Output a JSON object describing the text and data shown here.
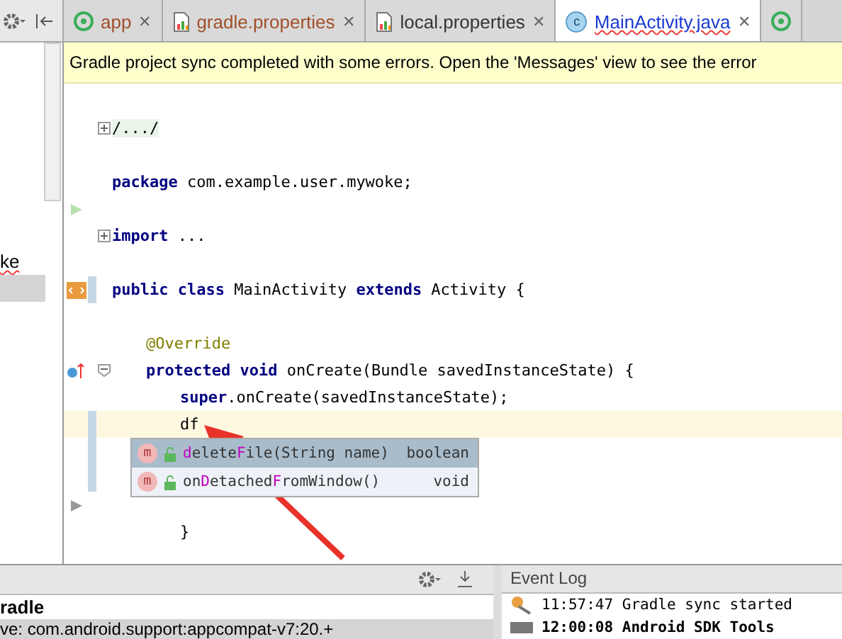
{
  "left_panel": {
    "tree": [
      {
        "text": "ke",
        "selected": false
      },
      {
        "selected": true
      }
    ]
  },
  "tabs": [
    {
      "label": "app",
      "kind": "android",
      "close": "✕",
      "selected": false
    },
    {
      "label": "gradle.properties",
      "kind": "properties",
      "close": "✕",
      "selected": false
    },
    {
      "label": "local.properties",
      "kind": "properties",
      "close": "✕",
      "selected": false
    },
    {
      "label": "MainActivity.java",
      "kind": "java",
      "icon_text": "c",
      "close": "✕",
      "selected": true
    },
    {
      "kind": "android",
      "selected": false
    }
  ],
  "banner": "Gradle project sync completed with some errors. Open the 'Messages' view to see the error",
  "code": [
    {
      "kind": "folded",
      "text": "/.../",
      "fold": {
        "kind": "plus"
      }
    },
    {
      "kind": "blank"
    },
    {
      "kind": "code",
      "text": "**package** com.example.user.mywoke;"
    },
    {
      "kind": "blank",
      "marker": {
        "kind": "run"
      }
    },
    {
      "kind": "code",
      "text": "**import** ...",
      "fold": {
        "kind": "plus"
      }
    },
    {
      "kind": "blank"
    },
    {
      "kind": "code",
      "text": "**public class** MainActivity **extends** Activity {",
      "marker": {
        "kind": "class"
      },
      "changed": true,
      "children": [
        {
          "kind": "blank"
        },
        {
          "kind": "annotation",
          "text": "@Override"
        },
        {
          "kind": "code",
          "text": "**protected void** onCreate(Bundle savedInstanceState) {",
          "marker": {
            "kind": "override"
          },
          "fold": {
            "kind": "minus"
          },
          "children": [
            {
              "kind": "code",
              "text": "**super**.onCreate(savedInstanceState);"
            },
            {
              "kind": "code",
              "text": "df",
              "current": true,
              "changed": true
            },
            {
              "kind": "blank",
              "changed": true
            },
            {
              "kind": "blank",
              "changed": true
            },
            {
              "kind": "blank",
              "marker": {
                "kind": "run-grey"
              }
            },
            {
              "kind": "code",
              "text": "}"
            }
          ]
        }
      ]
    }
  ],
  "completion": [
    {
      "icon_text": "m",
      "name": "**d**elete**F**ile(String name)",
      "type": "boolean",
      "selected": true
    },
    {
      "icon_text": "m",
      "name": "on**D**etached**F**romWindow()",
      "type": "void",
      "selected": false
    }
  ],
  "messages_panel": {
    "title": "radle",
    "rows": [
      {
        "text": "ve: com.android.support:appcompat-v7:20.+",
        "selected": true
      }
    ]
  },
  "event_log": {
    "title": "Event Log",
    "entries": [
      {
        "text": "11:57:47 Gradle sync started",
        "kind": "sync"
      },
      {
        "text": "12:00:08 Android SDK Tools",
        "kind": "sdk"
      }
    ]
  }
}
